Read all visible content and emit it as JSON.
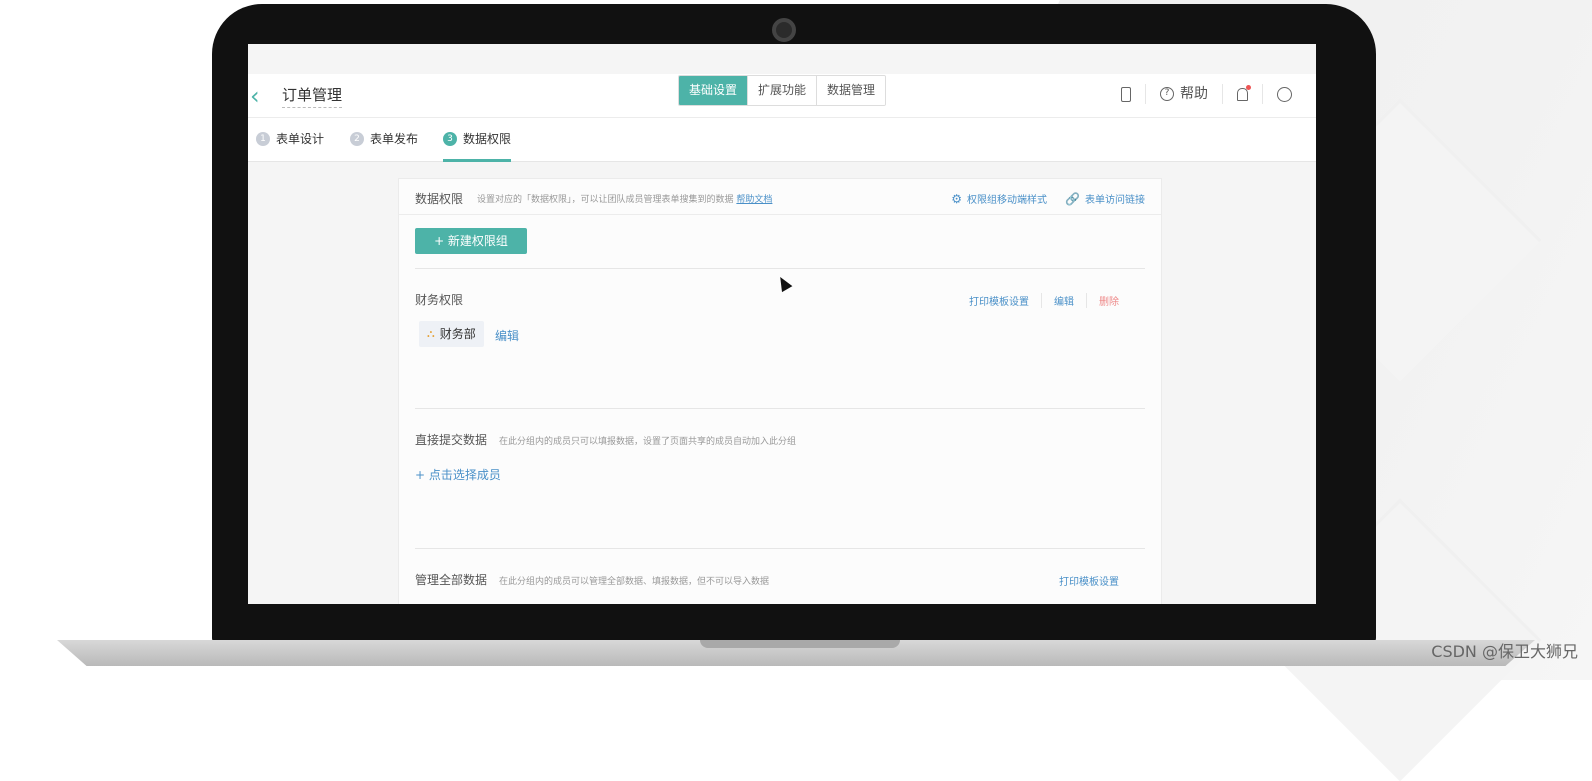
{
  "header": {
    "back_glyph": "‹",
    "app_title": "订单管理",
    "tabs": [
      {
        "label": "基础设置",
        "active": true
      },
      {
        "label": "扩展功能",
        "active": false
      },
      {
        "label": "数据管理",
        "active": false
      }
    ],
    "tools": {
      "help_label": "帮助"
    }
  },
  "steps": [
    {
      "num": "1",
      "label": "表单设计",
      "active": false
    },
    {
      "num": "2",
      "label": "表单发布",
      "active": false
    },
    {
      "num": "3",
      "label": "数据权限",
      "active": true
    }
  ],
  "card": {
    "title": "数据权限",
    "desc": "设置对应的「数据权限」，可以让团队成员管理表单搜集到的数据",
    "help_link": "帮助文档",
    "actions": {
      "mobile_style": "权限组移动端样式",
      "access_link": "表单访问链接"
    },
    "new_button": "+ 新建权限组",
    "sections": {
      "finance": {
        "title": "财务权限",
        "print_setting": "打印模板设置",
        "edit": "编辑",
        "delete": "删除",
        "dept_name": "财务部",
        "dept_edit": "编辑"
      },
      "submit": {
        "title": "直接提交数据",
        "sub": "在此分组内的成员只可以填报数据，设置了页面共享的成员自动加入此分组",
        "add_member": "+ 点击选择成员"
      },
      "manage": {
        "title": "管理全部数据",
        "sub": "在此分组内的成员可以管理全部数据、填报数据，但不可以导入数据",
        "print_setting": "打印模板设置"
      }
    }
  },
  "watermark": "CSDN @保卫大狮兄",
  "colors": {
    "accent": "#4db3a8",
    "link": "#4a90c8",
    "danger": "#ee8888"
  }
}
